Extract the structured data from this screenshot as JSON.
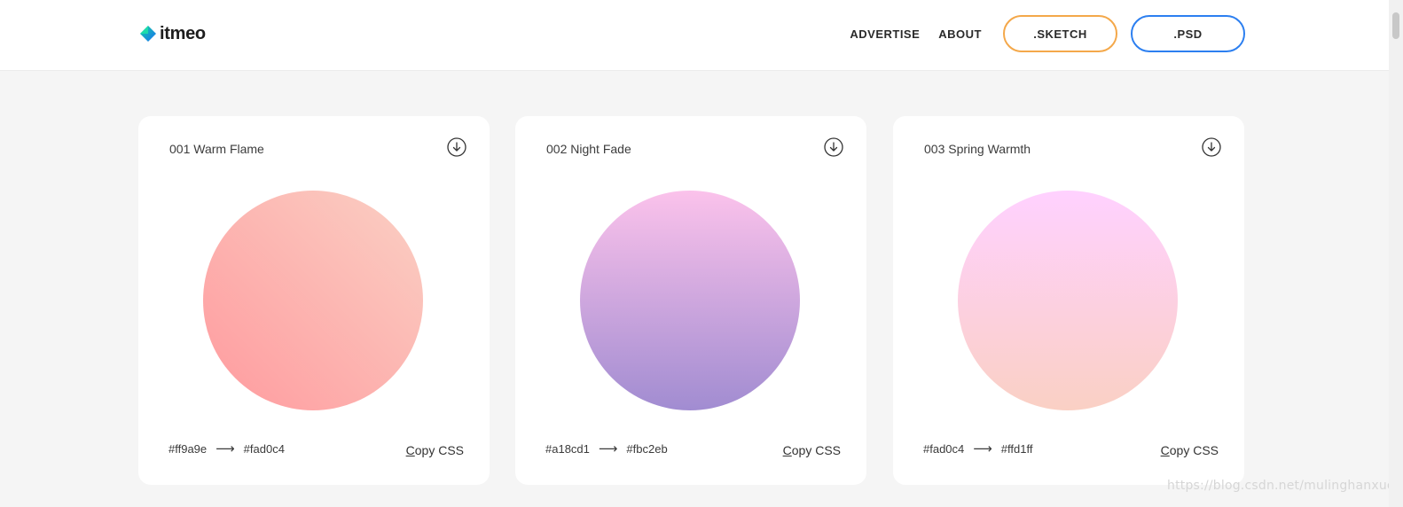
{
  "header": {
    "logo_text": "itmeo",
    "nav": {
      "advertise": "ADVERTISE",
      "about": "ABOUT",
      "sketch": ".SKETCH",
      "psd": ".PSD"
    },
    "colors": {
      "sketch_border": "#f4a84a",
      "psd_border": "#2c7ff0"
    }
  },
  "cards": [
    {
      "title": "001 Warm Flame",
      "color_from": "#ff9a9e",
      "color_to": "#fad0c4",
      "copy_first": "C",
      "copy_rest": "opy CSS"
    },
    {
      "title": "002 Night Fade",
      "color_from": "#a18cd1",
      "color_to": "#fbc2eb",
      "copy_first": "C",
      "copy_rest": "opy CSS"
    },
    {
      "title": "003 Spring Warmth",
      "color_from": "#fad0c4",
      "color_to": "#ffd1ff",
      "copy_first": "C",
      "copy_rest": "opy CSS"
    }
  ],
  "icons": {
    "download": "download-circle-icon",
    "arrow": "right-arrow-icon"
  },
  "watermark": "https://blog.csdn.net/mulinghanxue"
}
